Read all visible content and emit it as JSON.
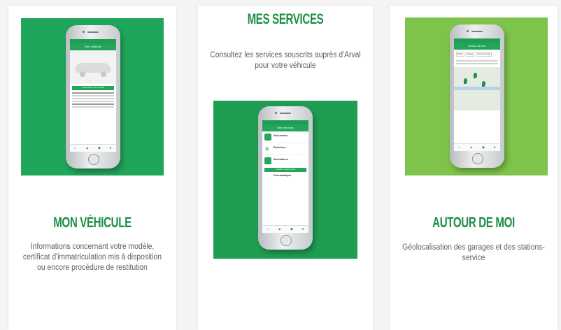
{
  "colors": {
    "brand_green": "#1f8f46",
    "hero_green_1": "#1fa65a",
    "hero_green_2": "#1f9e53",
    "hero_green_3": "#7fc44a"
  },
  "cards": [
    {
      "title": "MON VÉHICULE",
      "description": "Informations concernant votre modèle, certificat d'immatriculation mis à disposition ou encore procédure de restitution",
      "phone": {
        "header": "Mon véhicule",
        "button": "Personnaliser votre véhicule"
      }
    },
    {
      "title": "MES SERVICES",
      "description": "Consultez les services souscrits auprès d'Arval pour votre véhicule",
      "phone": {
        "header": "Mes services",
        "services": [
          "Assurance",
          "Entretien",
          "Assistance",
          "Pneumatique"
        ],
        "button": "Appeler le support Arval"
      }
    },
    {
      "title": "AUTOUR DE MOI",
      "description": "Géolocalisation des garages et des stations-service",
      "phone": {
        "header": "Autour de moi",
        "chips": [
          "Station",
          "Garage",
          "Centre de lavage"
        ]
      }
    }
  ]
}
